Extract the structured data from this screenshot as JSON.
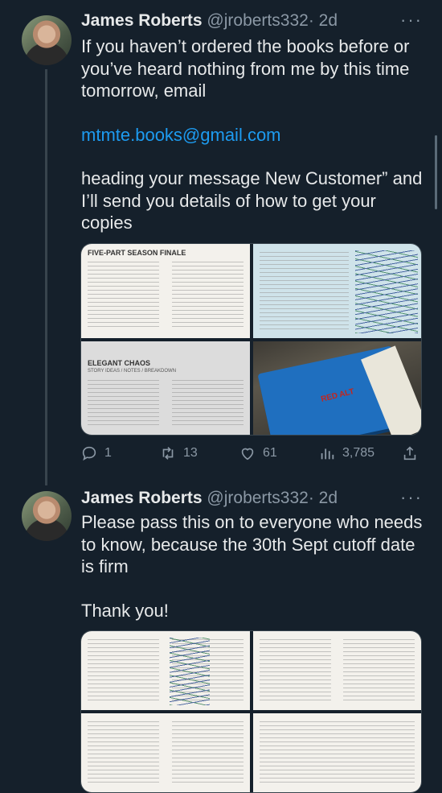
{
  "tweets": [
    {
      "author": {
        "name": "James Roberts",
        "handle": "@jroberts332",
        "time": "· 2d"
      },
      "more_icon": "ellipsis-icon",
      "text": {
        "line1": "If you haven’t ordered the books before or you’ve heard nothing from me by this time tomorrow, email",
        "email": "mtmte.books@gmail.com",
        "line2": "heading your message New Customer” and I’ll send you details of how to get your copies"
      },
      "media": [
        {
          "title": "FIVE-PART SEASON FINALE"
        },
        {
          "title": ""
        },
        {
          "title": "ELEGANT CHAOS",
          "subtitle": "STORY IDEAS / NOTES / BREAKDOWN"
        },
        {
          "title": "",
          "note": "RED ALT"
        }
      ],
      "stats": {
        "replies": "1",
        "retweets": "13",
        "likes": "61",
        "views": "3,785"
      }
    },
    {
      "author": {
        "name": "James Roberts",
        "handle": "@jroberts332",
        "time": "· 2d"
      },
      "more_icon": "ellipsis-icon",
      "text": {
        "line1": "Please pass this on to everyone who needs to know, because the 30th Sept cutoff date is firm",
        "line2": "Thank you!"
      }
    }
  ],
  "colors": {
    "background": "#15202b",
    "link": "#1d9bf0",
    "muted": "#8b98a5"
  }
}
